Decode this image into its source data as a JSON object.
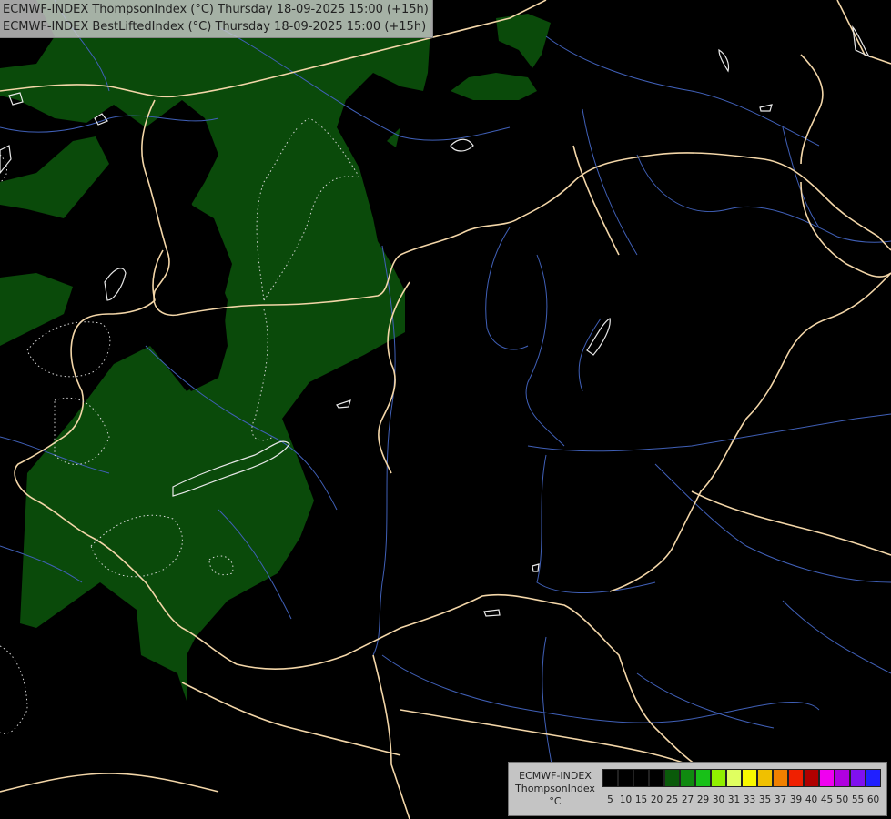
{
  "header": {
    "line1": "ECMWF-INDEX ThompsonIndex (°C) Thursday 18-09-2025 15:00 (+15h)",
    "line2": "ECMWF-INDEX BestLiftedIndex (°C) Thursday 18-09-2025 15:00 (+15h)"
  },
  "legend": {
    "model": "ECMWF-INDEX",
    "parameter": "ThompsonIndex",
    "unit": "°C",
    "ticks": [
      "5",
      "10",
      "15",
      "20",
      "25",
      "27",
      "29",
      "30",
      "31",
      "33",
      "35",
      "37",
      "39",
      "40",
      "45",
      "50",
      "55",
      "60"
    ],
    "colors": [
      "#000000",
      "#000000",
      "#000000",
      "#000000",
      "#0a5a0a",
      "#108a10",
      "#18c018",
      "#90f000",
      "#e0ff60",
      "#f8f800",
      "#f0c000",
      "#f08000",
      "#f02000",
      "#b00000",
      "#f000f0",
      "#b000e0",
      "#8010f0",
      "#2020ff"
    ]
  },
  "map": {
    "field_color": "#0a4a0a",
    "border_color": "#f3d6a8",
    "river_color": "#4060b8",
    "contour_color": "#d8d8d8"
  }
}
